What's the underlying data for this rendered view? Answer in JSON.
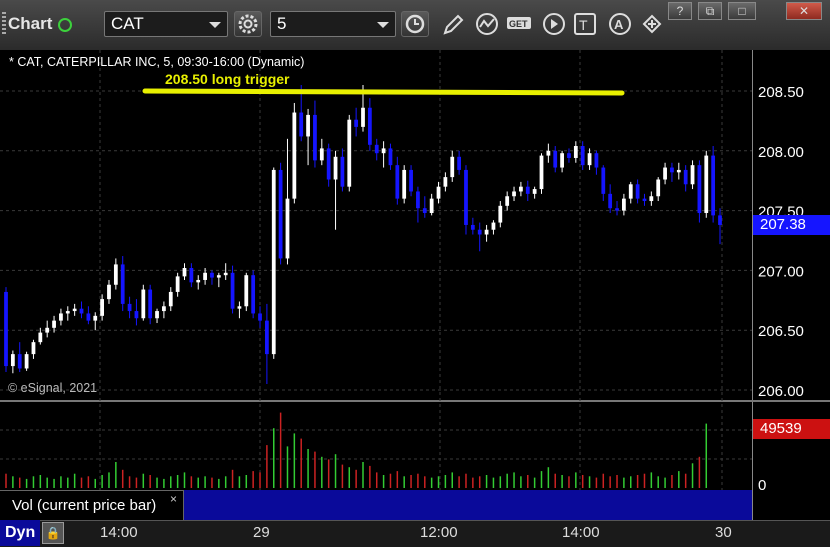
{
  "toolbar": {
    "title": "Chart",
    "symbol": "CAT",
    "interval": "5",
    "icons": [
      "gear-icon",
      "clock-icon",
      "pencil-icon",
      "study-icon",
      "get-icon",
      "play-icon",
      "text-icon",
      "alert-icon",
      "link-icon"
    ]
  },
  "window_buttons": [
    "?",
    "⧉",
    "□",
    "✕"
  ],
  "chart_info": "* CAT, CATERPILLAR INC, 5, 09:30-16:00 (Dynamic)",
  "copyright": "© eSignal, 2021",
  "volume_label": "Vol (current price bar)",
  "volume_close": "×",
  "dyn_label": "Dyn",
  "colors": {
    "up": "#ffffff",
    "down": "#1515ff",
    "trigger": "#e8f000",
    "vol_up": "#33cc33",
    "vol_down": "#cc2222",
    "last_price_bg": "#1515ff",
    "vol_tag_bg": "#cc1111"
  },
  "chart_data": {
    "type": "candlestick",
    "annotation": {
      "text": "208.50 long trigger",
      "price": 208.5
    },
    "ylim": [
      205.96,
      208.67
    ],
    "y_ticks": [
      "208.50",
      "208.00",
      "207.50",
      "207.00",
      "206.50",
      "206.00"
    ],
    "x_ticks": [
      "14:00",
      "29",
      "12:00",
      "14:00",
      "30"
    ],
    "last_price": "207.38",
    "volume_last": "49539",
    "volume_axis_zero": "0",
    "volume_max": 60000,
    "bars": [
      [
        206.82,
        206.86,
        206.15,
        206.2
      ],
      [
        206.2,
        206.33,
        206.14,
        206.3
      ],
      [
        206.3,
        206.4,
        206.15,
        206.18
      ],
      [
        206.18,
        206.32,
        206.16,
        206.3
      ],
      [
        206.3,
        206.42,
        206.26,
        206.4
      ],
      [
        206.4,
        206.52,
        206.38,
        206.48
      ],
      [
        206.48,
        206.58,
        206.44,
        206.52
      ],
      [
        206.52,
        206.62,
        206.48,
        206.58
      ],
      [
        206.58,
        206.68,
        206.54,
        206.64
      ],
      [
        206.64,
        206.7,
        206.58,
        206.66
      ],
      [
        206.66,
        206.72,
        206.62,
        206.68
      ],
      [
        206.68,
        206.74,
        206.6,
        206.64
      ],
      [
        206.64,
        206.7,
        206.55,
        206.58
      ],
      [
        206.58,
        206.65,
        206.5,
        206.62
      ],
      [
        206.62,
        206.8,
        206.58,
        206.76
      ],
      [
        206.76,
        206.92,
        206.72,
        206.88
      ],
      [
        206.88,
        207.1,
        206.84,
        207.05
      ],
      [
        207.05,
        207.12,
        206.66,
        206.72
      ],
      [
        206.72,
        206.78,
        206.6,
        206.66
      ],
      [
        206.66,
        206.76,
        206.54,
        206.6
      ],
      [
        206.6,
        206.88,
        206.58,
        206.84
      ],
      [
        206.84,
        206.88,
        206.55,
        206.6
      ],
      [
        206.6,
        206.68,
        206.56,
        206.66
      ],
      [
        206.66,
        206.74,
        206.6,
        206.7
      ],
      [
        206.7,
        206.86,
        206.66,
        206.82
      ],
      [
        206.82,
        206.98,
        206.78,
        206.95
      ],
      [
        206.95,
        207.06,
        206.92,
        207.02
      ],
      [
        207.02,
        207.06,
        206.86,
        206.9
      ],
      [
        206.9,
        206.96,
        206.84,
        206.92
      ],
      [
        206.92,
        207.02,
        206.88,
        206.98
      ],
      [
        206.98,
        207.0,
        206.88,
        206.94
      ],
      [
        206.94,
        206.98,
        206.86,
        206.96
      ],
      [
        206.96,
        207.06,
        206.92,
        206.98
      ],
      [
        206.98,
        207.04,
        206.64,
        206.68
      ],
      [
        206.68,
        206.74,
        206.6,
        206.7
      ],
      [
        206.7,
        206.98,
        206.66,
        206.96
      ],
      [
        206.96,
        207.0,
        206.6,
        206.64
      ],
      [
        206.64,
        206.7,
        206.52,
        206.58
      ],
      [
        206.58,
        206.72,
        206.05,
        206.3
      ],
      [
        206.3,
        207.86,
        206.26,
        207.84
      ],
      [
        207.84,
        207.9,
        207.05,
        207.1
      ],
      [
        207.1,
        208.1,
        207.05,
        207.6
      ],
      [
        207.6,
        208.4,
        207.56,
        208.32
      ],
      [
        208.32,
        208.55,
        208.08,
        208.12
      ],
      [
        208.12,
        208.35,
        207.88,
        208.3
      ],
      [
        208.3,
        208.42,
        207.86,
        207.92
      ],
      [
        207.92,
        208.1,
        207.88,
        208.02
      ],
      [
        208.02,
        208.06,
        207.7,
        207.76
      ],
      [
        207.76,
        208.0,
        207.34,
        207.95
      ],
      [
        207.95,
        208.02,
        207.66,
        207.7
      ],
      [
        207.7,
        208.3,
        207.66,
        208.26
      ],
      [
        208.26,
        208.36,
        208.12,
        208.2
      ],
      [
        208.2,
        208.55,
        208.16,
        208.36
      ],
      [
        208.36,
        208.44,
        208.0,
        208.05
      ],
      [
        208.05,
        208.1,
        207.92,
        207.98
      ],
      [
        207.98,
        208.08,
        207.86,
        208.02
      ],
      [
        208.02,
        208.06,
        207.84,
        207.88
      ],
      [
        207.88,
        207.95,
        207.55,
        207.6
      ],
      [
        207.6,
        207.88,
        207.56,
        207.84
      ],
      [
        207.84,
        207.88,
        207.62,
        207.66
      ],
      [
        207.66,
        207.7,
        207.4,
        207.52
      ],
      [
        207.52,
        207.62,
        207.44,
        207.48
      ],
      [
        207.48,
        207.64,
        207.46,
        207.6
      ],
      [
        207.6,
        207.74,
        207.56,
        207.7
      ],
      [
        207.7,
        207.82,
        207.66,
        207.78
      ],
      [
        207.78,
        208.0,
        207.74,
        207.95
      ],
      [
        207.95,
        208.0,
        207.8,
        207.84
      ],
      [
        207.84,
        207.88,
        207.3,
        207.38
      ],
      [
        207.38,
        207.44,
        207.3,
        207.34
      ],
      [
        207.34,
        207.4,
        207.16,
        207.3
      ],
      [
        207.3,
        207.38,
        207.24,
        207.34
      ],
      [
        207.34,
        207.42,
        207.3,
        207.4
      ],
      [
        207.4,
        207.58,
        207.36,
        207.54
      ],
      [
        207.54,
        207.66,
        207.5,
        207.62
      ],
      [
        207.62,
        207.7,
        207.58,
        207.66
      ],
      [
        207.66,
        207.74,
        207.62,
        207.7
      ],
      [
        207.7,
        207.75,
        207.58,
        207.64
      ],
      [
        207.64,
        207.7,
        207.6,
        207.68
      ],
      [
        207.68,
        207.98,
        207.64,
        207.96
      ],
      [
        207.96,
        208.06,
        207.9,
        208.0
      ],
      [
        208.0,
        208.04,
        207.82,
        207.86
      ],
      [
        207.86,
        208.0,
        207.82,
        207.98
      ],
      [
        207.98,
        208.02,
        207.9,
        207.94
      ],
      [
        207.94,
        208.08,
        207.9,
        208.04
      ],
      [
        208.04,
        208.08,
        207.84,
        207.88
      ],
      [
        207.88,
        208.02,
        207.84,
        207.98
      ],
      [
        207.98,
        208.0,
        207.8,
        207.86
      ],
      [
        207.86,
        207.88,
        207.58,
        207.64
      ],
      [
        207.64,
        207.72,
        207.48,
        207.52
      ],
      [
        207.52,
        207.58,
        207.46,
        207.5
      ],
      [
        207.5,
        207.64,
        207.46,
        207.6
      ],
      [
        207.6,
        207.74,
        207.56,
        207.72
      ],
      [
        207.72,
        207.76,
        207.56,
        207.6
      ],
      [
        207.6,
        207.64,
        207.54,
        207.58
      ],
      [
        207.58,
        207.66,
        207.54,
        207.62
      ],
      [
        207.62,
        207.78,
        207.58,
        207.76
      ],
      [
        207.76,
        207.9,
        207.72,
        207.86
      ],
      [
        207.86,
        207.9,
        207.74,
        207.82
      ],
      [
        207.82,
        207.9,
        207.76,
        207.84
      ],
      [
        207.84,
        207.88,
        207.66,
        207.72
      ],
      [
        207.72,
        207.92,
        207.68,
        207.88
      ],
      [
        207.88,
        207.92,
        207.4,
        207.48
      ],
      [
        207.48,
        208.0,
        207.44,
        207.96
      ],
      [
        207.96,
        208.04,
        207.4,
        207.46
      ],
      [
        207.46,
        207.52,
        207.22,
        207.38
      ]
    ],
    "volumes": [
      11000,
      9000,
      8000,
      7000,
      9000,
      10000,
      8000,
      7000,
      9000,
      8000,
      11000,
      8000,
      9000,
      7000,
      10000,
      12000,
      20000,
      14000,
      9000,
      8000,
      11000,
      10000,
      8000,
      7000,
      9000,
      10000,
      12000,
      9000,
      8000,
      9000,
      8000,
      7000,
      9000,
      14000,
      9000,
      10000,
      13000,
      12000,
      33000,
      46000,
      58000,
      32000,
      42000,
      38000,
      30000,
      28000,
      24000,
      22000,
      26000,
      18000,
      16000,
      14000,
      20000,
      17000,
      12000,
      10000,
      11000,
      13000,
      9000,
      10000,
      11000,
      9000,
      8000,
      9000,
      10000,
      12000,
      9000,
      11000,
      8000,
      9000,
      10000,
      8000,
      9000,
      11000,
      12000,
      9000,
      10000,
      8000,
      13000,
      16000,
      11000,
      10000,
      9000,
      12000,
      10000,
      9000,
      8000,
      11000,
      9000,
      10000,
      8000,
      9000,
      10000,
      11000,
      12000,
      9000,
      8000,
      10000,
      13000,
      11000,
      19000,
      24000,
      49539
    ]
  }
}
